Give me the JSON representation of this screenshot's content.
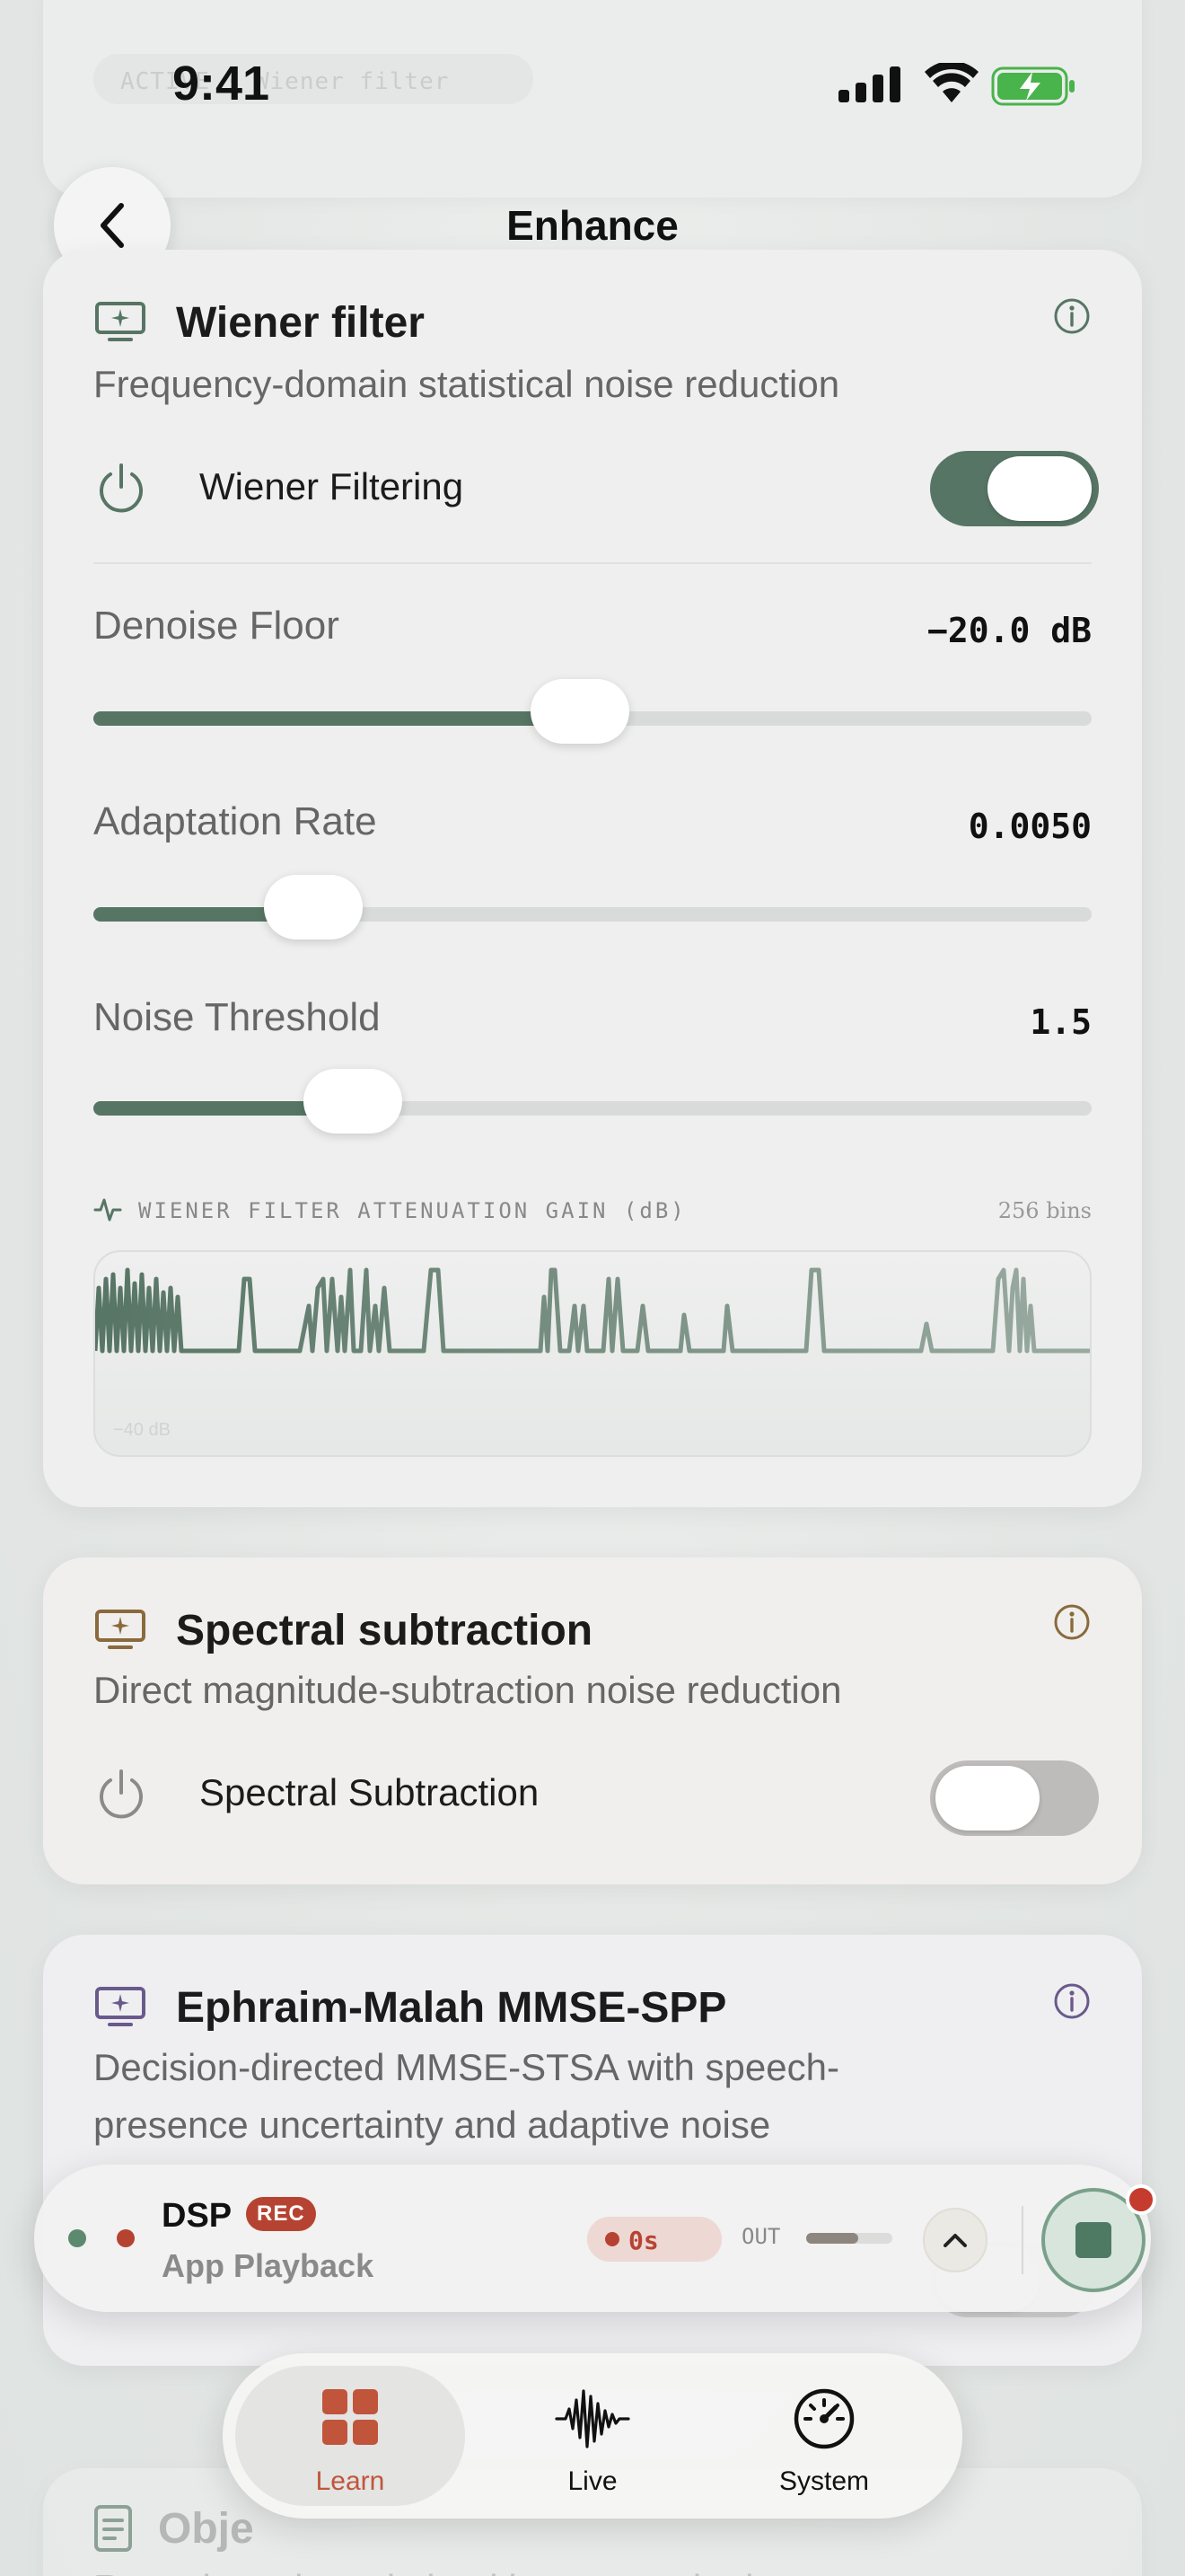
{
  "status": {
    "time": "9:41"
  },
  "header": {
    "title": "Enhance"
  },
  "ghost": {
    "chip_text": "ACTIVE  · Wiener filter"
  },
  "wiener": {
    "title": "Wiener filter",
    "subtitle": "Frequency-domain statistical noise reduction",
    "toggle_label": "Wiener Filtering",
    "toggle_on": true,
    "sliders": [
      {
        "label": "Denoise Floor",
        "value": "−20.0 dB",
        "fraction": 0.487
      },
      {
        "label": "Adaptation Rate",
        "value": "0.0050",
        "fraction": 0.22
      },
      {
        "label": "Noise Threshold",
        "value": "1.5",
        "fraction": 0.26
      }
    ],
    "chart": {
      "title": "WIENER FILTER ATTENUATION GAIN (dB)",
      "bins": "256 bins",
      "min_label": "−40 dB"
    }
  },
  "spectral": {
    "title": "Spectral subtraction",
    "subtitle": "Direct magnitude-subtraction noise reduction",
    "toggle_label": "Spectral Subtraction",
    "toggle_on": false
  },
  "ephraim": {
    "title": "Ephraim-Malah MMSE-SPP",
    "subtitle_1": "Decision-directed MMSE-STSA with speech-",
    "subtitle_2": "presence uncertainty and adaptive noise"
  },
  "object": {
    "title": "Obje",
    "subtitle": "Runs the selected algorithm on synthetic"
  },
  "player": {
    "name": "DSP",
    "badge": "REC",
    "source": "App Playback",
    "timer": "0s",
    "out_label": "OUT",
    "out_level": 0.6
  },
  "tabs": [
    {
      "label": "Learn",
      "active": true
    },
    {
      "label": "Live",
      "active": false
    },
    {
      "label": "System",
      "active": false
    }
  ],
  "colors": {
    "accent_green": "#577565",
    "rec_red": "#b64332",
    "learn_orange": "#c0553c",
    "spectral_brown": "#8a6a3c",
    "ephraim_purple": "#6a5a8c"
  }
}
